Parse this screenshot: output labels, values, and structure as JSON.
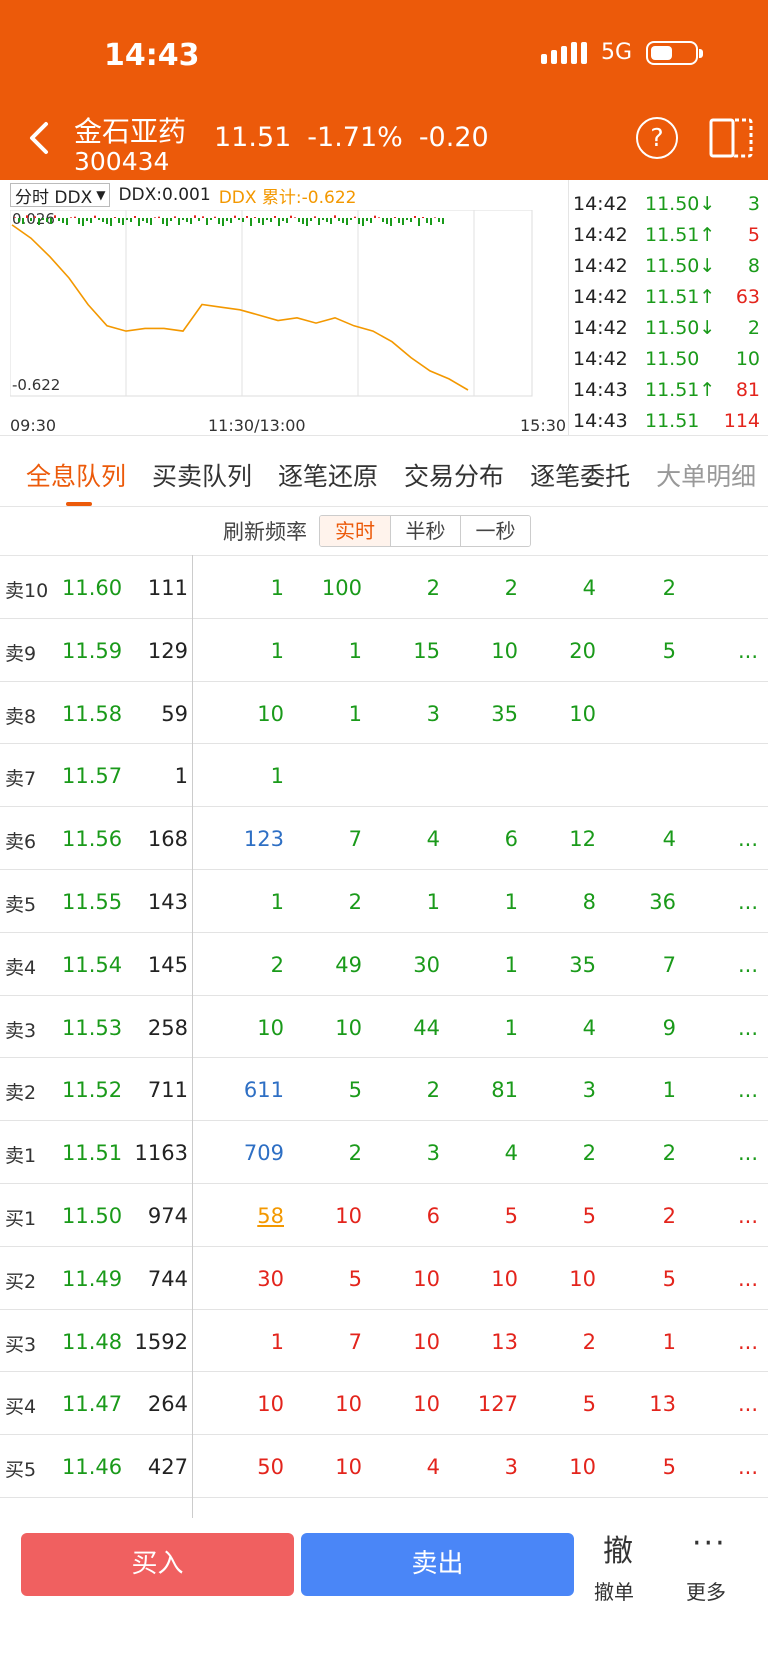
{
  "status": {
    "time": "14:43",
    "network": "5G"
  },
  "stock": {
    "name": "金石亚药",
    "code": "300434",
    "price": "11.51",
    "pct": "-1.71%",
    "change": "-0.20"
  },
  "ddx": {
    "selector": "分时 DDX",
    "value": "DDX:0.001",
    "cumulative": "DDX 累计:-0.622",
    "top_label": "0.026",
    "bottom_label": "-0.622"
  },
  "chart_axis": {
    "x_left": "09:30",
    "x_mid": "11:30/13:00",
    "x_right": "15:30"
  },
  "chart_data": {
    "type": "line",
    "title": "DDX 累计",
    "x": [
      "09:30",
      "11:30/13:00",
      "15:30"
    ],
    "ylim": [
      -0.622,
      0.026
    ],
    "series": [
      {
        "name": "DDX 累计",
        "values": [
          0.0,
          -0.05,
          -0.12,
          -0.2,
          -0.3,
          -0.38,
          -0.4,
          -0.39,
          -0.39,
          -0.4,
          -0.3,
          -0.31,
          -0.32,
          -0.34,
          -0.36,
          -0.35,
          -0.37,
          -0.35,
          -0.38,
          -0.4,
          -0.44,
          -0.5,
          -0.55,
          -0.58,
          -0.622
        ]
      }
    ]
  },
  "ticks": [
    {
      "time": "14:42",
      "price": "11.50↓",
      "vol": "3",
      "price_color": "green",
      "vol_color": "green"
    },
    {
      "time": "14:42",
      "price": "11.51↑",
      "vol": "5",
      "price_color": "green",
      "vol_color": "red"
    },
    {
      "time": "14:42",
      "price": "11.50↓",
      "vol": "8",
      "price_color": "green",
      "vol_color": "green"
    },
    {
      "time": "14:42",
      "price": "11.51↑",
      "vol": "63",
      "price_color": "green",
      "vol_color": "red"
    },
    {
      "time": "14:42",
      "price": "11.50↓",
      "vol": "2",
      "price_color": "green",
      "vol_color": "green"
    },
    {
      "time": "14:42",
      "price": "11.50",
      "vol": "10",
      "price_color": "green",
      "vol_color": "green"
    },
    {
      "time": "14:43",
      "price": "11.51↑",
      "vol": "81",
      "price_color": "green",
      "vol_color": "red"
    },
    {
      "time": "14:43",
      "price": "11.51",
      "vol": "114",
      "price_color": "green",
      "vol_color": "red"
    }
  ],
  "tabs": [
    "全息队列",
    "买卖队列",
    "逐笔还原",
    "交易分布",
    "逐笔委托",
    "大单明细"
  ],
  "refresh": {
    "label": "刷新频率",
    "options": [
      "实时",
      "半秒",
      "一秒"
    ]
  },
  "queue": [
    {
      "label": "卖10",
      "price": "11.60",
      "vol": "111",
      "cells": [
        "1",
        "100",
        "2",
        "2",
        "4",
        "2"
      ],
      "colors": [
        "g",
        "g",
        "g",
        "g",
        "g",
        "g"
      ],
      "more": ""
    },
    {
      "label": "卖9",
      "price": "11.59",
      "vol": "129",
      "cells": [
        "1",
        "1",
        "15",
        "10",
        "20",
        "5"
      ],
      "colors": [
        "g",
        "g",
        "g",
        "g",
        "g",
        "g"
      ],
      "more": "..."
    },
    {
      "label": "卖8",
      "price": "11.58",
      "vol": "59",
      "cells": [
        "10",
        "1",
        "3",
        "35",
        "10",
        ""
      ],
      "colors": [
        "g",
        "g",
        "g",
        "g",
        "g",
        "g"
      ],
      "more": ""
    },
    {
      "label": "卖7",
      "price": "11.57",
      "vol": "1",
      "cells": [
        "1",
        "",
        "",
        "",
        "",
        ""
      ],
      "colors": [
        "g",
        "g",
        "g",
        "g",
        "g",
        "g"
      ],
      "more": ""
    },
    {
      "label": "卖6",
      "price": "11.56",
      "vol": "168",
      "cells": [
        "123",
        "7",
        "4",
        "6",
        "12",
        "4"
      ],
      "colors": [
        "b",
        "g",
        "g",
        "g",
        "g",
        "g"
      ],
      "more": "..."
    },
    {
      "label": "卖5",
      "price": "11.55",
      "vol": "143",
      "cells": [
        "1",
        "2",
        "1",
        "1",
        "8",
        "36"
      ],
      "colors": [
        "g",
        "g",
        "g",
        "g",
        "g",
        "g"
      ],
      "more": "..."
    },
    {
      "label": "卖4",
      "price": "11.54",
      "vol": "145",
      "cells": [
        "2",
        "49",
        "30",
        "1",
        "35",
        "7"
      ],
      "colors": [
        "g",
        "g",
        "g",
        "g",
        "g",
        "g"
      ],
      "more": "..."
    },
    {
      "label": "卖3",
      "price": "11.53",
      "vol": "258",
      "cells": [
        "10",
        "10",
        "44",
        "1",
        "4",
        "9"
      ],
      "colors": [
        "g",
        "g",
        "g",
        "g",
        "g",
        "g"
      ],
      "more": "..."
    },
    {
      "label": "卖2",
      "price": "11.52",
      "vol": "711",
      "cells": [
        "611",
        "5",
        "2",
        "81",
        "3",
        "1"
      ],
      "colors": [
        "b",
        "g",
        "g",
        "g",
        "g",
        "g"
      ],
      "more": "..."
    },
    {
      "label": "卖1",
      "price": "11.51",
      "vol": "1163",
      "cells": [
        "709",
        "2",
        "3",
        "4",
        "2",
        "2"
      ],
      "colors": [
        "b",
        "g",
        "g",
        "g",
        "g",
        "g"
      ],
      "more": "..."
    },
    {
      "label": "买1",
      "price": "11.50",
      "vol": "974",
      "cells": [
        "58",
        "10",
        "6",
        "5",
        "5",
        "2"
      ],
      "colors": [
        "o",
        "r",
        "r",
        "r",
        "r",
        "r"
      ],
      "more": "..."
    },
    {
      "label": "买2",
      "price": "11.49",
      "vol": "744",
      "cells": [
        "30",
        "5",
        "10",
        "10",
        "10",
        "5"
      ],
      "colors": [
        "r",
        "r",
        "r",
        "r",
        "r",
        "r"
      ],
      "more": "..."
    },
    {
      "label": "买3",
      "price": "11.48",
      "vol": "1592",
      "cells": [
        "1",
        "7",
        "10",
        "13",
        "2",
        "1"
      ],
      "colors": [
        "r",
        "r",
        "r",
        "r",
        "r",
        "r"
      ],
      "more": "..."
    },
    {
      "label": "买4",
      "price": "11.47",
      "vol": "264",
      "cells": [
        "10",
        "10",
        "10",
        "127",
        "5",
        "13"
      ],
      "colors": [
        "r",
        "r",
        "r",
        "r",
        "r",
        "r"
      ],
      "more": "..."
    },
    {
      "label": "买5",
      "price": "11.46",
      "vol": "427",
      "cells": [
        "50",
        "10",
        "4",
        "3",
        "10",
        "5"
      ],
      "colors": [
        "r",
        "r",
        "r",
        "r",
        "r",
        "r"
      ],
      "more": "..."
    }
  ],
  "bottom": {
    "buy": "买入",
    "sell": "卖出",
    "cancel_icon": "撤",
    "cancel": "撤单",
    "more_icon": "···",
    "more": "更多"
  },
  "colors": {
    "header": "#EC5A0A",
    "green": "#1a9a1a",
    "red": "#e3241c",
    "blue": "#2e6fc4",
    "orange": "#F39800"
  }
}
